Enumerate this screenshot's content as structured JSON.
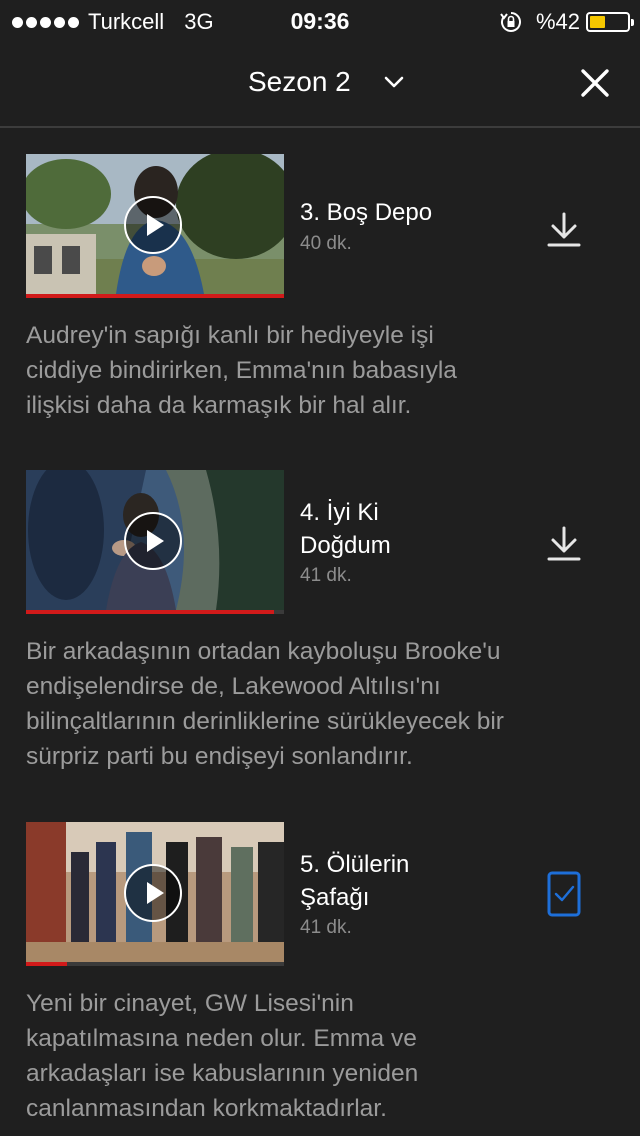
{
  "status_bar": {
    "carrier": "Turkcell",
    "network": "3G",
    "time": "09:36",
    "battery_percent": "%42",
    "battery_level": 0.42,
    "battery_color": "#f6c800"
  },
  "header": {
    "season_title": "Sezon 2",
    "chevron_icon": "chevron-down-icon",
    "close_icon": "close-icon"
  },
  "episodes": [
    {
      "title": "3. Boş Depo",
      "duration": "40 dk.",
      "description": "Audrey'in sapığı kanlı bir hediyeyle işi\nciddiye bindirirken, Emma'nın babasıyla\nilişkisi daha da karmaşık bir hal alır.",
      "progress": 1.0,
      "download_state": "download-icon"
    },
    {
      "title": "4. İyi Ki\nDoğdum",
      "duration": "41 dk.",
      "description": "Bir arkadaşının ortadan kayboluşu Brooke'u\nendişelendirse de, Lakewood Altılısı'nı\nbilinçaltlarının derinliklerine sürükleyecek bir\nsürpriz parti bu endişeyi sonlandırır.",
      "progress": 0.96,
      "download_state": "download-icon"
    },
    {
      "title": "5. Ölülerin\nŞafağı",
      "duration": "41 dk.",
      "description": "Yeni bir cinayet, GW Lisesi'nin\nkapatılmasına neden olur. Emma ve\narkadaşları ise kabuslarının yeniden\ncanlanmasından korkmaktadırlar.",
      "progress": 0.16,
      "download_state": "downloaded-phone-icon"
    }
  ],
  "colors": {
    "background": "#1f1f1f",
    "progress": "#d11a1a",
    "downloaded": "#1e6fd9",
    "muted_text": "#9b9b9b"
  }
}
